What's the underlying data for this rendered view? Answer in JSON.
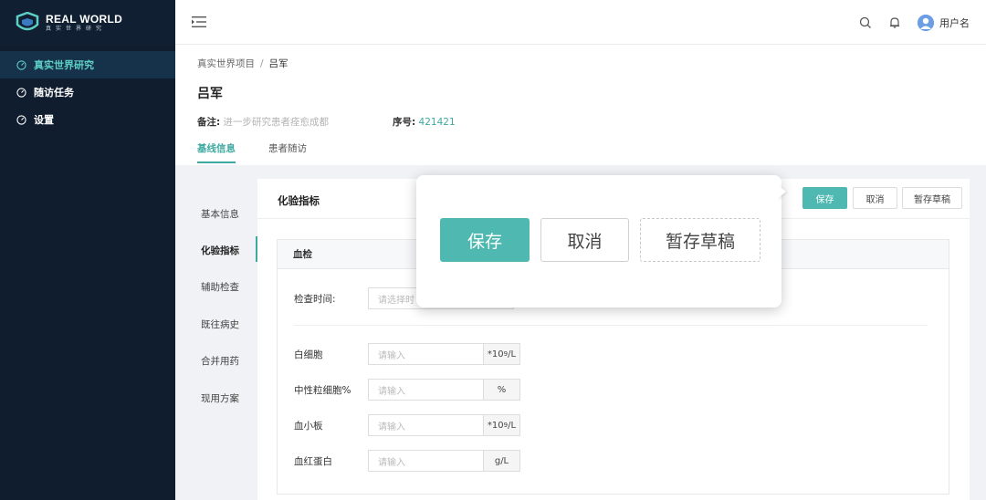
{
  "app": {
    "logo_title": "REAL WORLD",
    "logo_subtitle": "真实世界研究",
    "brand_color": "#4fb8b0"
  },
  "sidebar": {
    "items": [
      {
        "label": "真实世界研究",
        "icon": "gauge-icon",
        "active": true
      },
      {
        "label": "随访任务",
        "icon": "gauge-icon",
        "active": false
      },
      {
        "label": "设置",
        "icon": "gauge-icon",
        "active": false
      }
    ]
  },
  "header": {
    "menu_icon": "menu-fold-icon",
    "search_icon": "search-icon",
    "bell_icon": "bell-icon",
    "username": "用户名"
  },
  "page": {
    "breadcrumb": [
      "真实世界项目",
      "吕军"
    ],
    "breadcrumb_sep": "/",
    "title": "吕军",
    "note_label": "备注:",
    "note_value": "进一步研究患者痊愈成都",
    "serial_label": "序号:",
    "serial_value": "421421",
    "tabs": [
      {
        "label": "基线信息",
        "active": true
      },
      {
        "label": "患者随访",
        "active": false
      }
    ]
  },
  "sections": [
    {
      "label": "基本信息",
      "active": false
    },
    {
      "label": "化验指标",
      "active": true
    },
    {
      "label": "辅助检查",
      "active": false
    },
    {
      "label": "既往病史",
      "active": false
    },
    {
      "label": "合并用药",
      "active": false
    },
    {
      "label": "现用方案",
      "active": false
    }
  ],
  "card": {
    "title": "化验指标",
    "save_label": "保存",
    "cancel_label": "取消",
    "draft_label": "暂存草稿",
    "panel_title": "血检",
    "exam_time_label": "检查时间:",
    "exam_time_placeholder": "请选择时",
    "fields": [
      {
        "label": "白细胞",
        "placeholder": "请输入",
        "unit_prefix": "*10",
        "unit_sup": "9",
        "unit_suffix": "/L"
      },
      {
        "label": "中性粒细胞%",
        "placeholder": "请输入",
        "unit_prefix": "%",
        "unit_sup": "",
        "unit_suffix": ""
      },
      {
        "label": "血小板",
        "placeholder": "请输入",
        "unit_prefix": "*10",
        "unit_sup": "9",
        "unit_suffix": "/L"
      },
      {
        "label": "血红蛋白",
        "placeholder": "请输入",
        "unit_prefix": "g/L",
        "unit_sup": "",
        "unit_suffix": ""
      }
    ]
  },
  "callout": {
    "save_label": "保存",
    "cancel_label": "取消",
    "draft_label": "暂存草稿"
  }
}
